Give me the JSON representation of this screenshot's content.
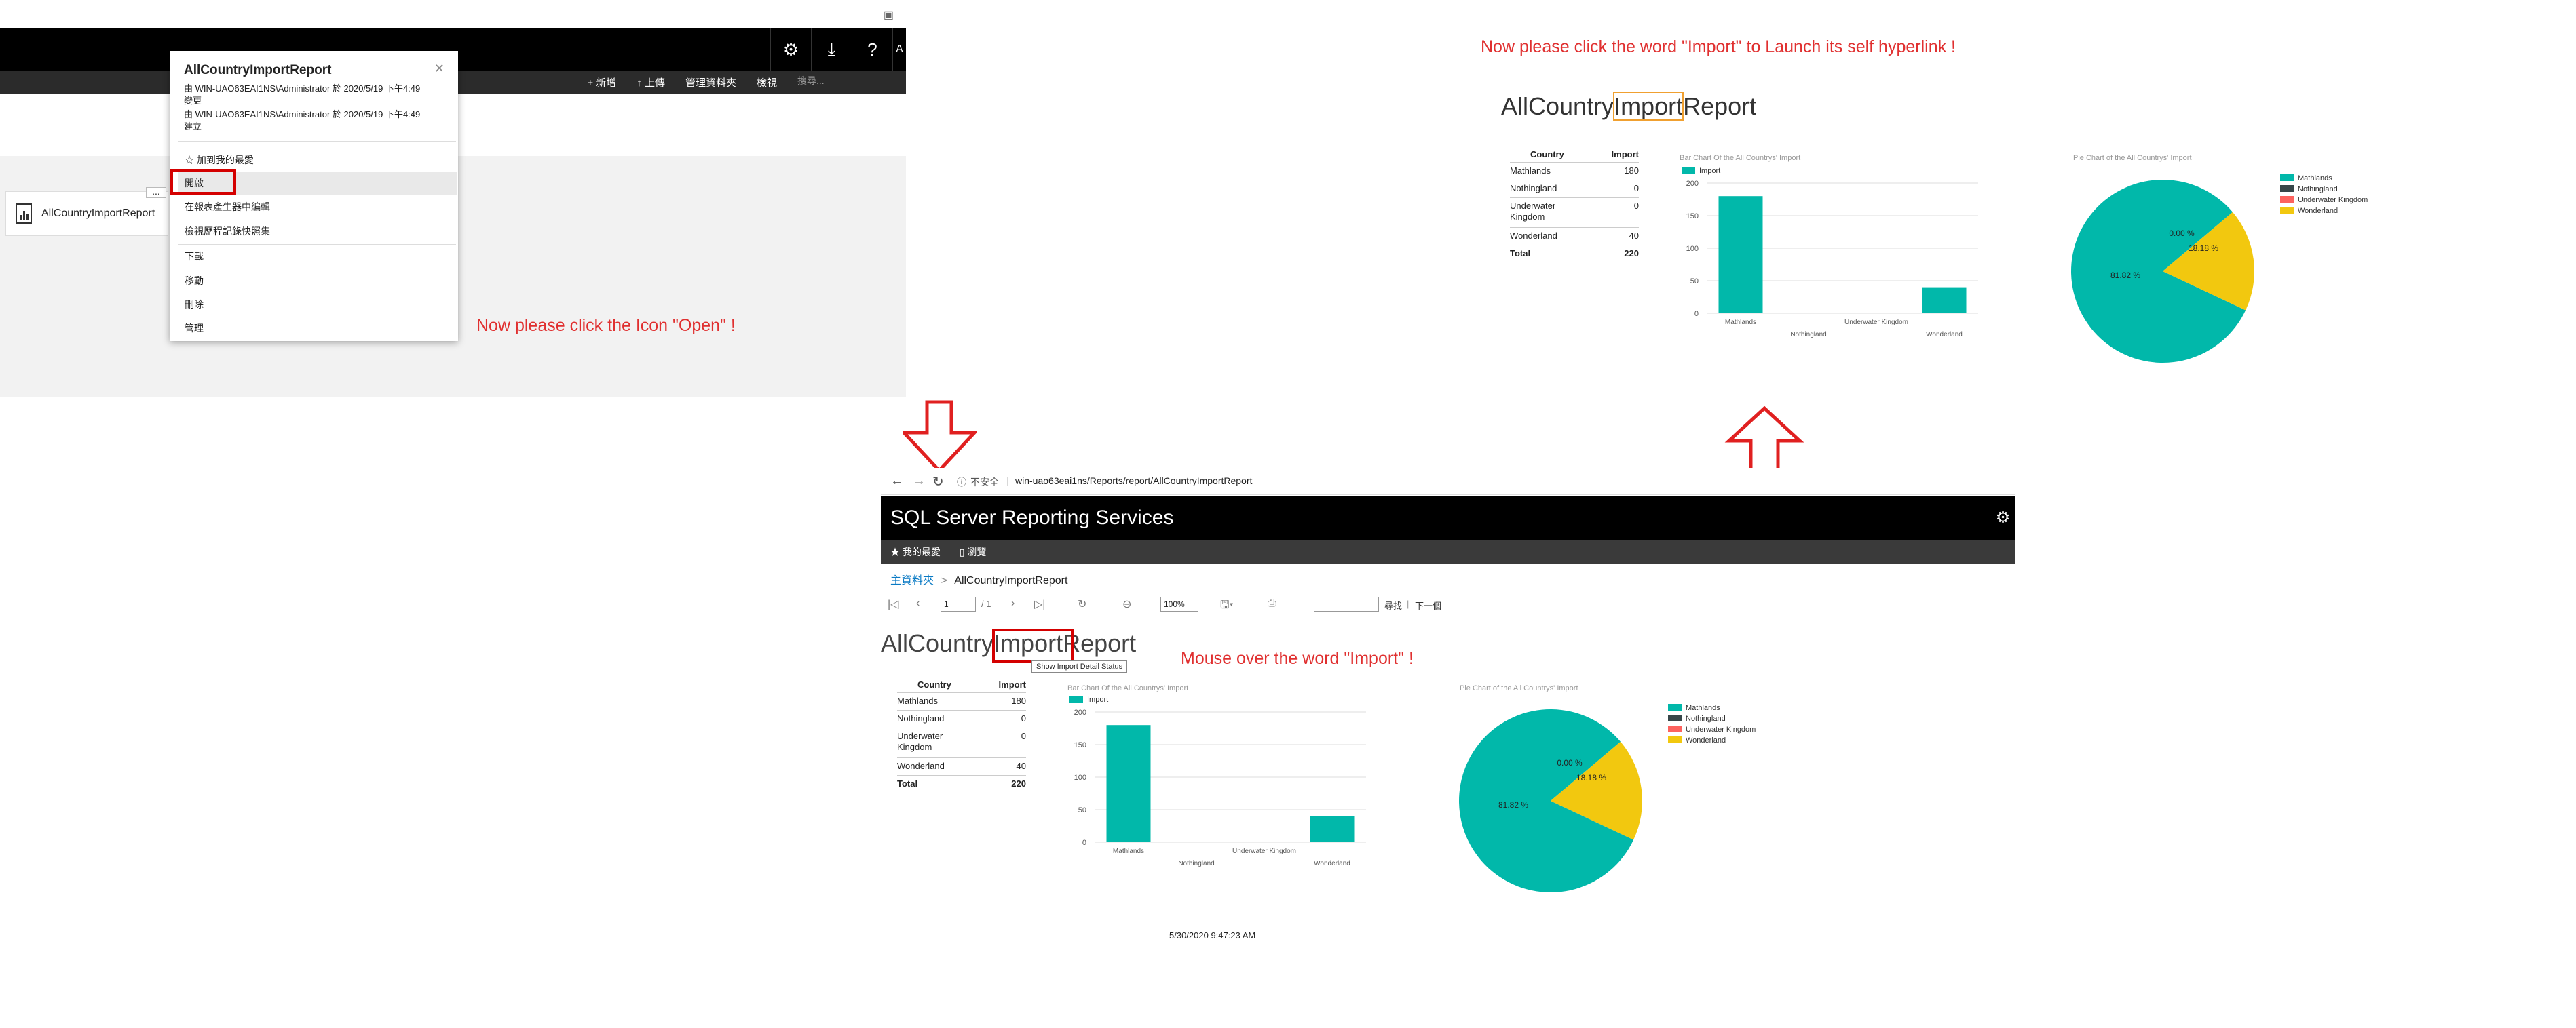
{
  "annotations": {
    "click_open": "Now please click the Icon \"Open\" !",
    "click_import": "Now please click the word \"Import\" to Launch its self hyperlink !",
    "mouse_over": "Mouse over the word \"Import\" !"
  },
  "portal": {
    "header_icons": [
      "gear-icon",
      "download-icon",
      "help-icon"
    ],
    "header_edge_text": "A",
    "toolbar": {
      "new": "+ 新增",
      "upload": "↑ 上傳",
      "manage_folder": "管理資料夾",
      "view": "檢視",
      "search_placeholder": "搜尋..."
    },
    "tile_name": "AllCountryImportReport",
    "tile_more": "...",
    "menu": {
      "title": "AllCountryImportReport",
      "created_line1": "由 WIN-UAO63EAI1NS\\Administrator 於 2020/5/19 下午4:49",
      "created_line2": "變更",
      "modified_line1": "由 WIN-UAO63EAI1NS\\Administrator 於 2020/5/19 下午4:49",
      "modified_line2": "建立",
      "items": [
        "☆ 加到我的最愛",
        "開啟",
        "在報表產生器中編輯",
        "檢視歷程記錄快照集",
        "下載",
        "移動",
        "刪除",
        "管理"
      ]
    }
  },
  "browser": {
    "security": "不安全",
    "url": "win-uao63eai1ns/Reports/report/AllCountryImportReport",
    "app_title": "SQL Server Reporting Services",
    "nav": {
      "favorites": "★ 我的最愛",
      "browse": "瀏覽"
    },
    "breadcrumb": {
      "home": "主資料夾",
      "sep": ">",
      "current": "AllCountryImportReport"
    },
    "report_toolbar": {
      "page": "1",
      "of": "/ 1",
      "zoom": "100%",
      "find": "尋找",
      "find_sep": "|",
      "next": "下一個"
    },
    "tooltip": "Show Import Detail Status",
    "timestamp": "5/30/2020 9:47:23 AM"
  },
  "report": {
    "title_pre": "AllCountry",
    "title_link": "Import",
    "title_post": "Report",
    "table": {
      "headers": [
        "Country",
        "Import"
      ],
      "rows": [
        [
          "Mathlands",
          "180"
        ],
        [
          "Nothingland",
          "0"
        ],
        [
          "Underwater Kingdom",
          "0"
        ],
        [
          "Wonderland",
          "40"
        ]
      ],
      "total_label": "Total",
      "total_value": "220"
    },
    "bar_title": "Bar Chart Of the All Countrys' Import",
    "pie_title": "Pie Chart of the All Countrys' Import"
  },
  "colors": {
    "teal": "#01b8aa",
    "dark": "#374649",
    "red": "#fd625e",
    "yellow": "#f2c80f",
    "annotation": "#e03030"
  },
  "chart_data": [
    {
      "type": "bar",
      "title": "Bar Chart Of the All Countrys' Import",
      "categories": [
        "Mathlands",
        "Nothingland",
        "Underwater Kingdom",
        "Wonderland"
      ],
      "series": [
        {
          "name": "Import",
          "values": [
            180,
            0,
            0,
            40
          ]
        }
      ],
      "yticks": [
        0,
        50,
        100,
        150,
        200
      ],
      "ylim": [
        0,
        200
      ],
      "grid": true,
      "legend": "top-left"
    },
    {
      "type": "pie",
      "title": "Pie Chart of the All Countrys' Import",
      "categories": [
        "Mathlands",
        "Nothingland",
        "Underwater Kingdom",
        "Wonderland"
      ],
      "values": [
        180,
        0,
        0,
        40
      ],
      "labels": [
        "81.82 %",
        "0.00 %",
        "18.18 %"
      ],
      "legend": "right"
    }
  ]
}
